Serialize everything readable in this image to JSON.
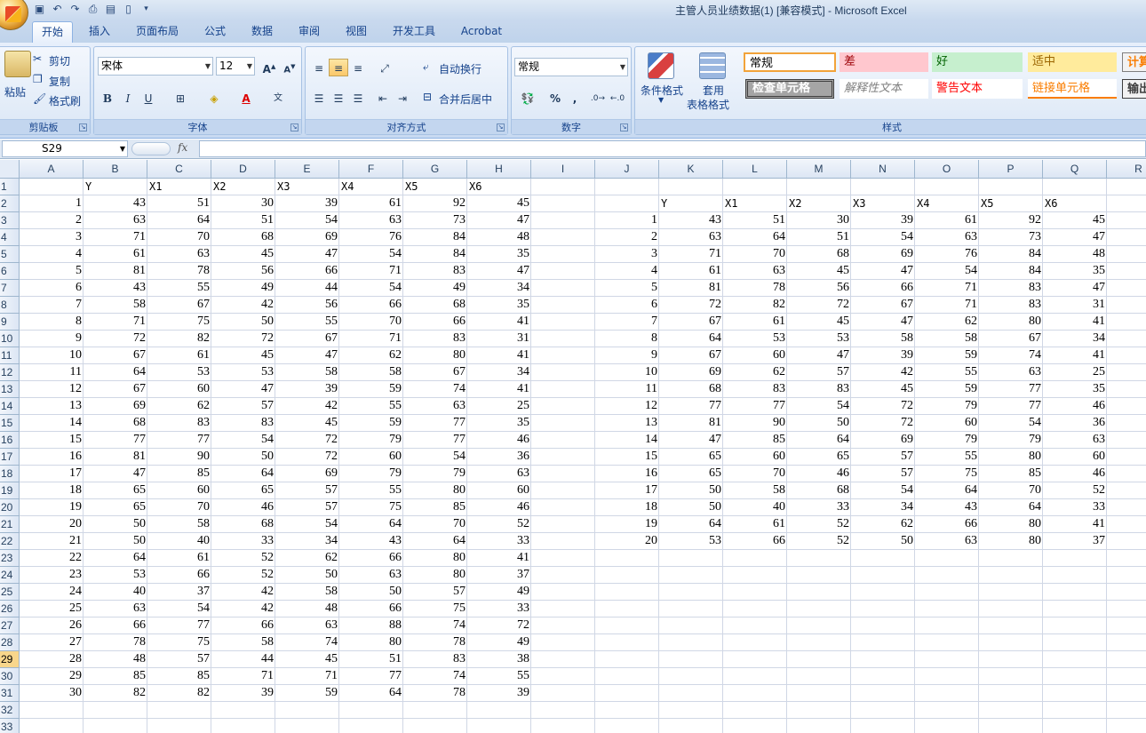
{
  "window": {
    "title": "主管人员业绩数据(1)  [兼容模式] - Microsoft Excel"
  },
  "tabs": [
    "开始",
    "插入",
    "页面布局",
    "公式",
    "数据",
    "审阅",
    "视图",
    "开发工具",
    "Acrobat"
  ],
  "ribbon": {
    "clipboard": {
      "paste": "粘贴",
      "cut": "剪切",
      "copy": "复制",
      "format_painter": "格式刷",
      "label": "剪贴板"
    },
    "font": {
      "name": "宋体",
      "size": "12",
      "label": "字体"
    },
    "alignment": {
      "wrap": "自动换行",
      "merge": "合并后居中",
      "label": "对齐方式"
    },
    "number": {
      "format": "常规",
      "percent": "%",
      "comma": ",",
      "label": "数字"
    },
    "styles": {
      "conditional_format": "条件格式",
      "table_format_1": "套用",
      "table_format_2": "表格格式",
      "label": "样式",
      "cells": [
        {
          "text": "常规",
          "bg": "#ffffff",
          "fg": "#000000"
        },
        {
          "text": "差",
          "bg": "#ffc7ce",
          "fg": "#9c0006"
        },
        {
          "text": "好",
          "bg": "#c6efce",
          "fg": "#006100"
        },
        {
          "text": "适中",
          "bg": "#ffeb9c",
          "fg": "#9c6500"
        },
        {
          "text": "计算",
          "bg": "#f2f2f2",
          "fg": "#fa7d00"
        },
        {
          "text": "检查单元格",
          "bg": "#a5a5a5",
          "fg": "#ffffff"
        },
        {
          "text": "解释性文本",
          "bg": "#ffffff",
          "fg": "#7f7f7f"
        },
        {
          "text": "警告文本",
          "bg": "#ffffff",
          "fg": "#ff0000"
        },
        {
          "text": "链接单元格",
          "bg": "#ffffff",
          "fg": "#fa7d00"
        },
        {
          "text": "输出",
          "bg": "#f2f2f2",
          "fg": "#3f3f3f"
        }
      ]
    }
  },
  "formula_bar": {
    "name_box": "S29",
    "fx": "fx",
    "value": ""
  },
  "sheet": {
    "columns": [
      "A",
      "B",
      "C",
      "D",
      "E",
      "F",
      "G",
      "H",
      "I",
      "J",
      "K",
      "L",
      "M",
      "N",
      "O",
      "P",
      "Q",
      "R"
    ],
    "rows": [
      "1",
      "2",
      "3",
      "4",
      "5",
      "6",
      "7",
      "8",
      "9",
      "10",
      "11",
      "12",
      "13",
      "14",
      "15",
      "16",
      "17",
      "18",
      "19",
      "20",
      "21",
      "22",
      "23",
      "24",
      "25",
      "26",
      "27",
      "28",
      "29",
      "30",
      "31",
      "32",
      "33"
    ],
    "selected_row": "29",
    "table1": {
      "headers": [
        "Y",
        "X1",
        "X2",
        "X3",
        "X4",
        "X5",
        "X6"
      ],
      "rows": [
        [
          1,
          43,
          51,
          30,
          39,
          61,
          92,
          45
        ],
        [
          2,
          63,
          64,
          51,
          54,
          63,
          73,
          47
        ],
        [
          3,
          71,
          70,
          68,
          69,
          76,
          84,
          48
        ],
        [
          4,
          61,
          63,
          45,
          47,
          54,
          84,
          35
        ],
        [
          5,
          81,
          78,
          56,
          66,
          71,
          83,
          47
        ],
        [
          6,
          43,
          55,
          49,
          44,
          54,
          49,
          34
        ],
        [
          7,
          58,
          67,
          42,
          56,
          66,
          68,
          35
        ],
        [
          8,
          71,
          75,
          50,
          55,
          70,
          66,
          41
        ],
        [
          9,
          72,
          82,
          72,
          67,
          71,
          83,
          31
        ],
        [
          10,
          67,
          61,
          45,
          47,
          62,
          80,
          41
        ],
        [
          11,
          64,
          53,
          53,
          58,
          58,
          67,
          34
        ],
        [
          12,
          67,
          60,
          47,
          39,
          59,
          74,
          41
        ],
        [
          13,
          69,
          62,
          57,
          42,
          55,
          63,
          25
        ],
        [
          14,
          68,
          83,
          83,
          45,
          59,
          77,
          35
        ],
        [
          15,
          77,
          77,
          54,
          72,
          79,
          77,
          46
        ],
        [
          16,
          81,
          90,
          50,
          72,
          60,
          54,
          36
        ],
        [
          17,
          47,
          85,
          64,
          69,
          79,
          79,
          63
        ],
        [
          18,
          65,
          60,
          65,
          57,
          55,
          80,
          60
        ],
        [
          19,
          65,
          70,
          46,
          57,
          75,
          85,
          46
        ],
        [
          20,
          50,
          58,
          68,
          54,
          64,
          70,
          52
        ],
        [
          21,
          50,
          40,
          33,
          34,
          43,
          64,
          33
        ],
        [
          22,
          64,
          61,
          52,
          62,
          66,
          80,
          41
        ],
        [
          23,
          53,
          66,
          52,
          50,
          63,
          80,
          37
        ],
        [
          24,
          40,
          37,
          42,
          58,
          50,
          57,
          49
        ],
        [
          25,
          63,
          54,
          42,
          48,
          66,
          75,
          33
        ],
        [
          26,
          66,
          77,
          66,
          63,
          88,
          74,
          72
        ],
        [
          27,
          78,
          75,
          58,
          74,
          80,
          78,
          49
        ],
        [
          28,
          48,
          57,
          44,
          45,
          51,
          83,
          38
        ],
        [
          29,
          85,
          85,
          71,
          71,
          77,
          74,
          55
        ],
        [
          30,
          82,
          82,
          39,
          59,
          64,
          78,
          39
        ]
      ]
    },
    "table2": {
      "headers": [
        "Y",
        "X1",
        "X2",
        "X3",
        "X4",
        "X5",
        "X6"
      ],
      "rows": [
        [
          1,
          43,
          51,
          30,
          39,
          61,
          92,
          45
        ],
        [
          2,
          63,
          64,
          51,
          54,
          63,
          73,
          47
        ],
        [
          3,
          71,
          70,
          68,
          69,
          76,
          84,
          48
        ],
        [
          4,
          61,
          63,
          45,
          47,
          54,
          84,
          35
        ],
        [
          5,
          81,
          78,
          56,
          66,
          71,
          83,
          47
        ],
        [
          6,
          72,
          82,
          72,
          67,
          71,
          83,
          31
        ],
        [
          7,
          67,
          61,
          45,
          47,
          62,
          80,
          41
        ],
        [
          8,
          64,
          53,
          53,
          58,
          58,
          67,
          34
        ],
        [
          9,
          67,
          60,
          47,
          39,
          59,
          74,
          41
        ],
        [
          10,
          69,
          62,
          57,
          42,
          55,
          63,
          25
        ],
        [
          11,
          68,
          83,
          83,
          45,
          59,
          77,
          35
        ],
        [
          12,
          77,
          77,
          54,
          72,
          79,
          77,
          46
        ],
        [
          13,
          81,
          90,
          50,
          72,
          60,
          54,
          36
        ],
        [
          14,
          47,
          85,
          64,
          69,
          79,
          79,
          63
        ],
        [
          15,
          65,
          60,
          65,
          57,
          55,
          80,
          60
        ],
        [
          16,
          65,
          70,
          46,
          57,
          75,
          85,
          46
        ],
        [
          17,
          50,
          58,
          68,
          54,
          64,
          70,
          52
        ],
        [
          18,
          50,
          40,
          33,
          34,
          43,
          64,
          33
        ],
        [
          19,
          64,
          61,
          52,
          62,
          66,
          80,
          41
        ],
        [
          20,
          53,
          66,
          52,
          50,
          63,
          80,
          37
        ]
      ]
    }
  }
}
